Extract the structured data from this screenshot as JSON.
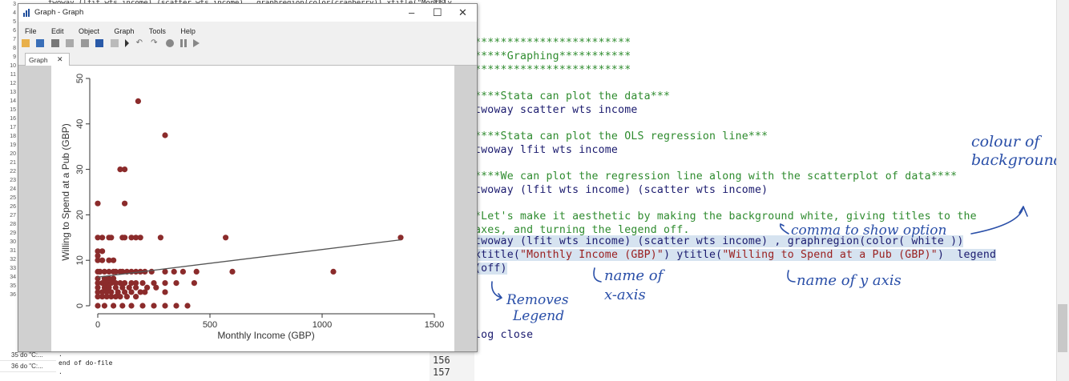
{
  "background": {
    "top_strip": "twoway (lfit wts income) (scatter wts income) , graphregion(color(cranberry)) xtitle(\"Monthly",
    "top_number": "132",
    "left_line_numbers": [
      "3",
      "4",
      "5",
      "6",
      "7",
      "8",
      "9",
      "10",
      "11",
      "12",
      "13",
      "14",
      "15",
      "16",
      "17",
      "18",
      "19",
      "20",
      "21",
      "22",
      "23",
      "24",
      "25",
      "26",
      "27",
      "28",
      "29",
      "30",
      "31",
      "32",
      "33",
      "34",
      "35",
      "36"
    ],
    "code_lines": [
      {
        "text": "************************",
        "cls": "cmt",
        "y": 46
      },
      {
        "text": "*****Graphing***********",
        "cls": "cmt",
        "y": 63
      },
      {
        "text": "************************",
        "cls": "cmt",
        "y": 80
      },
      {
        "text": "****Stata can plot the data***",
        "cls": "cmt",
        "y": 113
      },
      {
        "text": "twoway scatter wts income",
        "cls": "",
        "y": 130
      },
      {
        "text": "****Stata can plot the OLS regression line***",
        "cls": "cmt",
        "y": 163
      },
      {
        "text": "twoway lfit wts income",
        "cls": "",
        "y": 180
      },
      {
        "text": "****We can plot the regression line along with the scatterplot of data****",
        "cls": "cmt",
        "y": 213
      },
      {
        "text": "twoway (lfit wts income) (scatter wts income)",
        "cls": "",
        "y": 230
      },
      {
        "text": "*Let's make it aesthetic by making the background white, giving titles to the",
        "cls": "cmt",
        "y": 263
      },
      {
        "text": "axes, and turning the legend off.",
        "cls": "cmt",
        "y": 280
      },
      {
        "text": "log close",
        "cls": "",
        "y": 411
      }
    ],
    "hl_line1": "twoway (lfit wts income) (scatter wts income) , graphregion(color( white ))",
    "hl_line2a": "xtitle(",
    "hl_line2b": "\"Monthly Income (GBP)\"",
    "hl_line2c": ") ytitle(",
    "hl_line2d": "\"Willing to Spend at a Pub (GBP)\"",
    "hl_line2e": ")  legend",
    "hl_line3": "(off)"
  },
  "annotations": {
    "colour": "colour of",
    "background": "background",
    "comma": "comma to show option",
    "removes": "Removes",
    "legend": "Legend",
    "name_of": "name of",
    "x_axis": "x-axis",
    "name_y": "name of y axis"
  },
  "history": {
    "items": [
      "35 do \"C:...",
      "36 do \"C:..."
    ]
  },
  "results": {
    "lines": [
      ".",
      "end of do-file",
      "."
    ]
  },
  "linenums": [
    "156",
    "157"
  ],
  "graph_window": {
    "title": "Graph - Graph",
    "menu": [
      "File",
      "Edit",
      "Object",
      "Graph",
      "Tools",
      "Help"
    ],
    "tab": "Graph",
    "minimize": "–",
    "maximize": "☐",
    "close": "✕"
  },
  "chart_data": {
    "type": "scatter",
    "xlabel": "Monthly Income (GBP)",
    "ylabel": "Willing to Spend at a Pub (GBP)",
    "xlim": [
      0,
      1500
    ],
    "ylim": [
      0,
      50
    ],
    "xticks": [
      0,
      500,
      1000,
      1500
    ],
    "yticks": [
      0,
      10,
      20,
      30,
      40,
      50
    ],
    "marker_color": "#8b2b2b",
    "line_color": "#555555",
    "fit_line": {
      "x": [
        0,
        1350
      ],
      "y": [
        6.3,
        14.5
      ]
    },
    "points": [
      [
        180,
        45
      ],
      [
        300,
        37.5
      ],
      [
        100,
        30
      ],
      [
        120,
        30
      ],
      [
        0,
        22.5
      ],
      [
        120,
        22.5
      ],
      [
        0,
        15
      ],
      [
        20,
        15
      ],
      [
        50,
        15
      ],
      [
        60,
        15
      ],
      [
        110,
        15
      ],
      [
        120,
        15
      ],
      [
        150,
        15
      ],
      [
        170,
        15
      ],
      [
        190,
        15
      ],
      [
        280,
        15
      ],
      [
        570,
        15
      ],
      [
        1350,
        15
      ],
      [
        0,
        10
      ],
      [
        20,
        10
      ],
      [
        50,
        10
      ],
      [
        70,
        10
      ],
      [
        0,
        12
      ],
      [
        20,
        12
      ],
      [
        0,
        11
      ],
      [
        0,
        7.5
      ],
      [
        10,
        7.5
      ],
      [
        30,
        7.5
      ],
      [
        50,
        7.5
      ],
      [
        70,
        7.5
      ],
      [
        80,
        7.5
      ],
      [
        100,
        7.5
      ],
      [
        110,
        7.5
      ],
      [
        130,
        7.5
      ],
      [
        150,
        7.5
      ],
      [
        170,
        7.5
      ],
      [
        190,
        7.5
      ],
      [
        210,
        7.5
      ],
      [
        240,
        7.5
      ],
      [
        300,
        7.5
      ],
      [
        340,
        7.5
      ],
      [
        380,
        7.5
      ],
      [
        440,
        7.5
      ],
      [
        600,
        7.5
      ],
      [
        1050,
        7.5
      ],
      [
        0,
        6
      ],
      [
        30,
        6
      ],
      [
        50,
        6
      ],
      [
        70,
        6
      ],
      [
        0,
        5
      ],
      [
        20,
        5
      ],
      [
        40,
        5
      ],
      [
        60,
        5
      ],
      [
        80,
        5
      ],
      [
        100,
        5
      ],
      [
        120,
        5
      ],
      [
        150,
        5
      ],
      [
        170,
        5
      ],
      [
        200,
        5
      ],
      [
        250,
        5
      ],
      [
        300,
        5
      ],
      [
        350,
        5
      ],
      [
        430,
        5
      ],
      [
        0,
        4
      ],
      [
        30,
        4
      ],
      [
        50,
        4
      ],
      [
        80,
        4
      ],
      [
        110,
        4
      ],
      [
        140,
        4
      ],
      [
        170,
        4
      ],
      [
        220,
        4
      ],
      [
        260,
        4
      ],
      [
        0,
        3
      ],
      [
        20,
        3
      ],
      [
        40,
        3
      ],
      [
        60,
        3
      ],
      [
        90,
        3
      ],
      [
        120,
        3
      ],
      [
        150,
        3
      ],
      [
        190,
        3
      ],
      [
        210,
        3
      ],
      [
        300,
        3
      ],
      [
        0,
        2
      ],
      [
        20,
        2
      ],
      [
        40,
        2
      ],
      [
        60,
        2
      ],
      [
        80,
        2
      ],
      [
        100,
        2
      ],
      [
        130,
        2
      ],
      [
        170,
        2
      ],
      [
        0,
        0
      ],
      [
        30,
        0
      ],
      [
        70,
        0
      ],
      [
        110,
        0
      ],
      [
        150,
        0
      ],
      [
        200,
        0
      ],
      [
        250,
        0
      ],
      [
        300,
        0
      ],
      [
        350,
        0
      ],
      [
        400,
        0
      ]
    ]
  }
}
